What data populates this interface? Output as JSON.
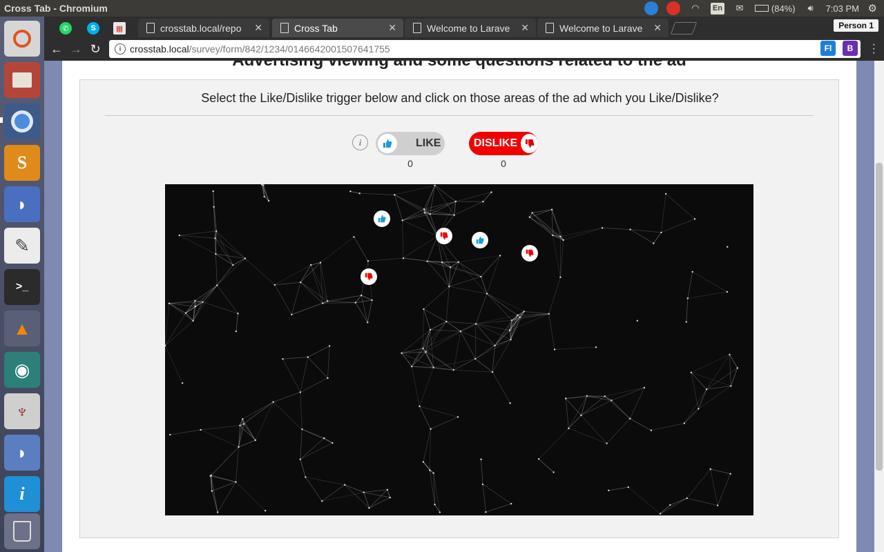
{
  "os_panel": {
    "window_title": "Cross Tab - Chromium",
    "battery": "(84%)",
    "clock": "7:03 PM",
    "keyboard": "En"
  },
  "browser": {
    "tabs": [
      {
        "label": "crosstab.local/repo",
        "active": false
      },
      {
        "label": "Cross Tab",
        "active": true
      },
      {
        "label": "Welcome to Larave",
        "active": false
      },
      {
        "label": "Welcome to Larave",
        "active": false
      }
    ],
    "profile": "Person 1",
    "url_host": "crosstab.local",
    "url_path": "/survey/form/842/1234/0146642001507641755",
    "ext1": "Fl",
    "ext2": "B"
  },
  "page": {
    "heading": "Advertising viewing and some questions related to the ad",
    "prompt": "Select the Like/Dislike trigger below and click on those areas of the ad which you Like/Dislike?",
    "like_label": "LIKE",
    "dislike_label": "DISLIKE",
    "like_count": "0",
    "dislike_count": "0",
    "info_glyph": "i"
  },
  "markers": [
    {
      "type": "like"
    },
    {
      "type": "dislike"
    },
    {
      "type": "like"
    },
    {
      "type": "dislike"
    },
    {
      "type": "dislike"
    }
  ],
  "colors": {
    "like_blue": "#1a9ad6",
    "dislike_red": "#f00000",
    "ad_background": "#0b0b0b"
  }
}
